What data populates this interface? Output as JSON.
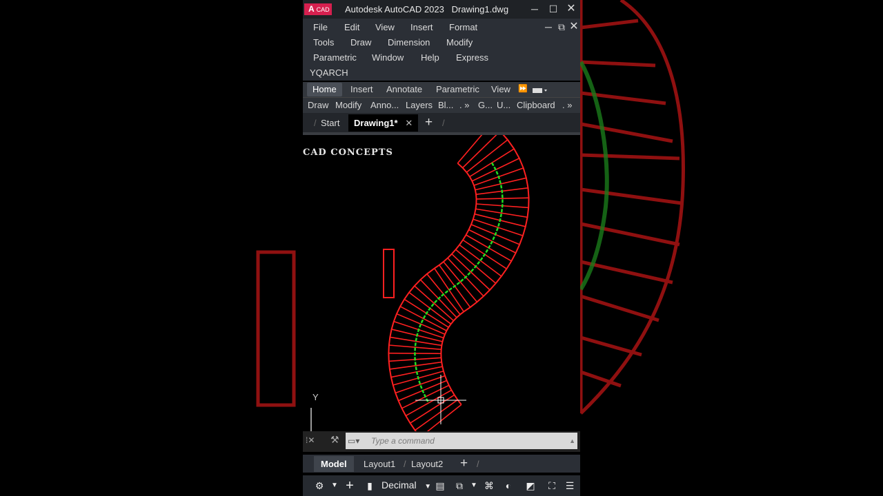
{
  "window": {
    "logo_letter": "A",
    "logo_text": "CAD",
    "title": "Autodesk AutoCAD 2023",
    "filename": "Drawing1.dwg",
    "minimize_glyph": "─",
    "maximize_glyph": "☐",
    "close_glyph": "✕",
    "doc_min_glyph": "─",
    "doc_restore_glyph": "⧉",
    "doc_close_glyph": "✕"
  },
  "menu": {
    "items": [
      "File",
      "Edit",
      "View",
      "Insert",
      "Format",
      "Tools",
      "Draw",
      "Dimension",
      "Modify",
      "Parametric",
      "Window",
      "Help",
      "Express",
      "YQARCH"
    ]
  },
  "ribbon": {
    "tabs": [
      "Home",
      "Insert",
      "Annotate",
      "Parametric",
      "View"
    ],
    "overflow_glyph": "⏩",
    "panels": [
      "Draw",
      "Modify",
      "Anno...",
      "Layers",
      "Bl...",
      ". »",
      "G...",
      "U...",
      "Clipboard",
      ". »"
    ]
  },
  "file_tabs": {
    "start": "Start",
    "active": "Drawing1*",
    "close_glyph": "✕",
    "add_glyph": "+"
  },
  "drawing": {
    "watermark": "CAD CONCEPTS",
    "ucs_y_label": "Y",
    "colors": {
      "stair": "#ff2020",
      "path": "#22dd22",
      "crosshair": "#ffffff"
    }
  },
  "command": {
    "placeholder": "Type a command"
  },
  "layout_tabs": {
    "model": "Model",
    "layout1": "Layout1",
    "layout2": "Layout2",
    "add_glyph": "+"
  },
  "status": {
    "units": "Decimal",
    "icons": [
      "gear-icon",
      "grid-plus-icon",
      "units-icon",
      "properties-icon",
      "viewport-icon",
      "workspace-icon",
      "isolate-icon",
      "annotation-icon",
      "fullscreen-icon",
      "menu-icon"
    ]
  }
}
